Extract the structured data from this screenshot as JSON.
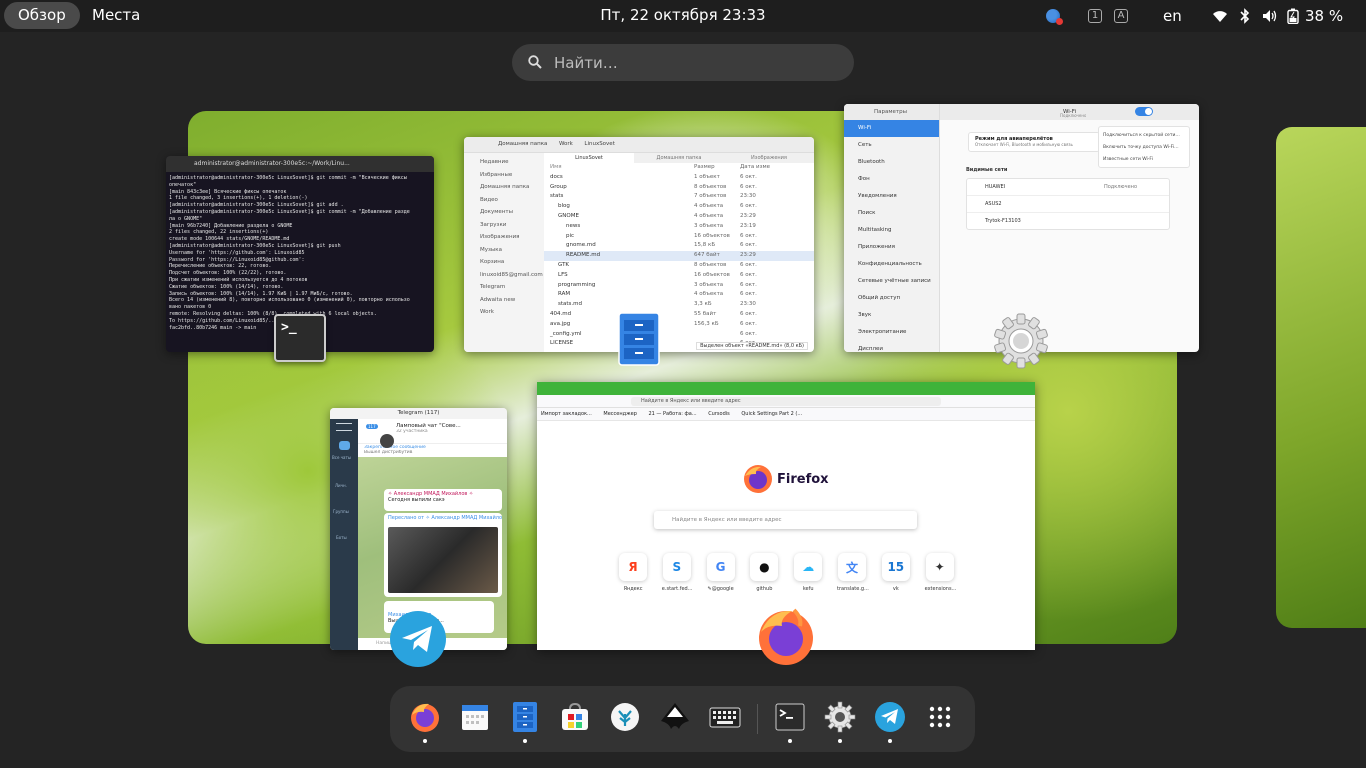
{
  "topbar": {
    "overview": "Обзор",
    "places": "Места",
    "clock": "Пт, 22 октября  23:33",
    "layout": "en",
    "battery": "38 %",
    "kbd1": "1",
    "kbdA": "A"
  },
  "search": {
    "placeholder": "Найти…"
  },
  "terminal": {
    "title": "administrator@administrator-300e5c:~/Work/Linu...",
    "lines": [
      "[administrator@administrator-300e5c LinuxSovet]$ git commit -m \"Всяческие фиксы",
      "опечаток\"",
      "[main 843c3ee] Всяческие фиксы опечаток",
      " 1 file changed, 3 insertions(+), 1 deletion(-)",
      "[administrator@administrator-300e5c LinuxSovet]$ git add .",
      "[administrator@administrator-300e5c LinuxSovet]$ git commit -m \"Добавление разде",
      "ла о GNOME\"",
      "[main 96b7240] Добавление раздела о GNOME",
      " 2 files changed, 22 insertions(+)",
      " create mode 100644 stats/GNOME/README.md",
      "[administrator@administrator-300e5c LinuxSovet]$ git push",
      "Username for 'https://github.com': Linuxoid85",
      "Password for 'https://Linuxoid85@github.com':",
      "Перечисление объектов: 22, готово.",
      "Подсчет объектов: 100% (22/22), готово.",
      "При сжатии изменений используется до 4 потоков",
      "Сжатие объектов: 100% (14/14), готово.",
      "Запись объектов: 100% (14/14), 1.97 КиБ | 1.97 МиБ/с, готово.",
      "Всего 14 (изменений 8), повторно использовано 0 (изменений 0), повторно использо",
      "вано пакетов 0",
      "remote: Resolving deltas: 100% (8/8), completed with 6 local objects.",
      "To https://github.com/Linuxoid85/...",
      "   fac2bfd..80b7246  main -> main"
    ]
  },
  "files": {
    "path": [
      "Домашняя папка",
      "Work",
      "LinuxSovet"
    ],
    "sidebar": [
      "Недавние",
      "Избранные",
      "Домашняя папка",
      "Видео",
      "Документы",
      "Загрузки",
      "Изображения",
      "Музыка",
      "Корзина",
      "linuxoid85@gmail.com",
      "Telegram",
      "Adwaita new",
      "Work"
    ],
    "tabs": [
      "LinuxSovet",
      "Домашняя папка",
      "Изображения"
    ],
    "columns": {
      "name": "Имя",
      "size": "Размер",
      "date": "Дата изменения"
    },
    "rows": [
      {
        "name": "docs",
        "size": "1 объект",
        "date": "6 окт."
      },
      {
        "name": "Group",
        "size": "8 объектов",
        "date": "6 окт."
      },
      {
        "name": "stats",
        "size": "7 объектов",
        "date": "23:30"
      },
      {
        "name": "blog",
        "size": "4 объекта",
        "date": "6 окт."
      },
      {
        "name": "GNOME",
        "size": "4 объекта",
        "date": "23:29"
      },
      {
        "name": "news",
        "size": "3 объекта",
        "date": "23:19"
      },
      {
        "name": "pic",
        "size": "16 объектов",
        "date": "6 окт."
      },
      {
        "name": "gnome.md",
        "size": "15,8 кБ",
        "date": "6 окт."
      },
      {
        "name": "README.md",
        "size": "647 байт",
        "date": "23:29"
      },
      {
        "name": "GTK",
        "size": "8 объектов",
        "date": "6 окт."
      },
      {
        "name": "LFS",
        "size": "16 объектов",
        "date": "6 окт."
      },
      {
        "name": "programming",
        "size": "3 объекта",
        "date": "6 окт."
      },
      {
        "name": "RAM",
        "size": "4 объекта",
        "date": "6 окт."
      },
      {
        "name": "stats.md",
        "size": "3,3 кБ",
        "date": "23:30"
      },
      {
        "name": "404.md",
        "size": "55 байт",
        "date": "6 окт."
      },
      {
        "name": "ava.jpg",
        "size": "156,3 кБ",
        "date": "6 окт."
      },
      {
        "name": "_config.yml",
        "size": "",
        "date": "6 окт."
      },
      {
        "name": "LICENSE",
        "size": "",
        "date": "6 окт."
      }
    ],
    "status": "Выделен объект «README.md» (8,0 кБ)"
  },
  "settings": {
    "title": "Параметры",
    "page_title": "Wi-Fi",
    "page_subtitle": "Подключено",
    "sidebar": [
      "Wi-Fi",
      "Сеть",
      "Bluetooth",
      "Фон",
      "Уведомления",
      "Поиск",
      "Multitasking",
      "Приложения",
      "Конфиденциальность",
      "Сетевые учётные записи",
      "Общий доступ",
      "Звук",
      "Электропитание",
      "Дисплеи"
    ],
    "airplane_title": "Режим для авиаперелётов",
    "airplane_desc": "Отключает Wi-Fi, Bluetooth и мобильную связь",
    "visible_title": "Видимые сети",
    "networks": [
      {
        "name": "HUAWEI",
        "status": "Подключено"
      },
      {
        "name": "ASUS2",
        "status": ""
      },
      {
        "name": "Trytok-F13103",
        "status": ""
      }
    ],
    "menu": [
      "Подключиться к скрытой сети…",
      "Включить точку доступа Wi-Fi…",
      "Известные сети Wi-Fi"
    ]
  },
  "telegram": {
    "title": "Telegram (117)",
    "chat_name": "Ламповый чат \"Сове...",
    "chat_members": "32 участника",
    "pinned_label": "Закреплённое сообщение",
    "pinned_text": "Вышел дистрибутив",
    "msg1_author": "✧ Александр ММАД Михайлов ✧",
    "msg1_text": "Сегодня выпили сакэ",
    "msg1_time": "21:25",
    "msg2_header": "Переслано от ✧ Александр ММАД Михайлов ✧",
    "msg3_author": "Михаил Краснов",
    "msg3_text": "Вышел релиз • иде...",
    "rail": [
      "Все чаты",
      "Личн.",
      "Группы",
      "Боты"
    ],
    "badge": "117",
    "composer": "Напишите сообщение..."
  },
  "firefox": {
    "url_placeholder": "Найдите в Яндекс или введите адрес",
    "bookmarks": [
      "Импорт закладок...",
      "Мессенджер",
      "21 — Работа: фа...",
      "Cursodis",
      "Quick Settings Part 2 (..."
    ],
    "brand": "Firefox",
    "search_placeholder": "Найдите в Яндекс или введите адрес",
    "tiles": [
      {
        "label": "Яндекс",
        "glyph": "Я",
        "color": "#fc3f1d"
      },
      {
        "label": "e.start.fed...",
        "glyph": "S",
        "color": "#1e88e5"
      },
      {
        "label": "✎@google",
        "glyph": "G",
        "color": "#4285f4"
      },
      {
        "label": "github",
        "glyph": "●",
        "color": "#111111"
      },
      {
        "label": "kefu",
        "glyph": "☁",
        "color": "#29b6f6"
      },
      {
        "label": "translate.g...",
        "glyph": "文",
        "color": "#4285f4"
      },
      {
        "label": "vk",
        "glyph": "15",
        "color": "#1976d2"
      },
      {
        "label": "extensions...",
        "glyph": "✦",
        "color": "#333333"
      }
    ]
  },
  "dash": {
    "items": [
      {
        "name": "firefox",
        "running": true
      },
      {
        "name": "calendar",
        "running": false
      },
      {
        "name": "files",
        "running": true
      },
      {
        "name": "software",
        "running": false
      },
      {
        "name": "app-5",
        "running": false
      },
      {
        "name": "inkscape",
        "running": false
      },
      {
        "name": "keyboard",
        "running": false
      },
      {
        "name": "terminal",
        "running": true
      },
      {
        "name": "settings",
        "running": true
      },
      {
        "name": "telegram",
        "running": true
      },
      {
        "name": "show-apps",
        "running": false
      }
    ]
  }
}
